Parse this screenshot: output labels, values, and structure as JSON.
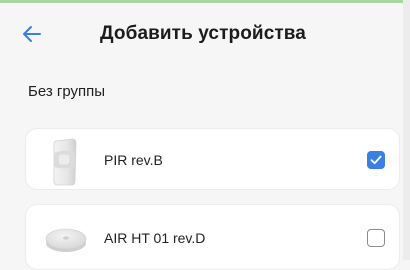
{
  "header": {
    "title": "Добавить устройства",
    "back_icon": "arrow-left-icon",
    "accent_color": "#3a7fe3"
  },
  "group": {
    "label": "Без группы"
  },
  "devices": [
    {
      "name": "PIR rev.B",
      "icon": "motion-sensor-image",
      "checked": true
    },
    {
      "name": "AIR HT 01 rev.D",
      "icon": "round-sensor-image",
      "checked": false
    }
  ]
}
